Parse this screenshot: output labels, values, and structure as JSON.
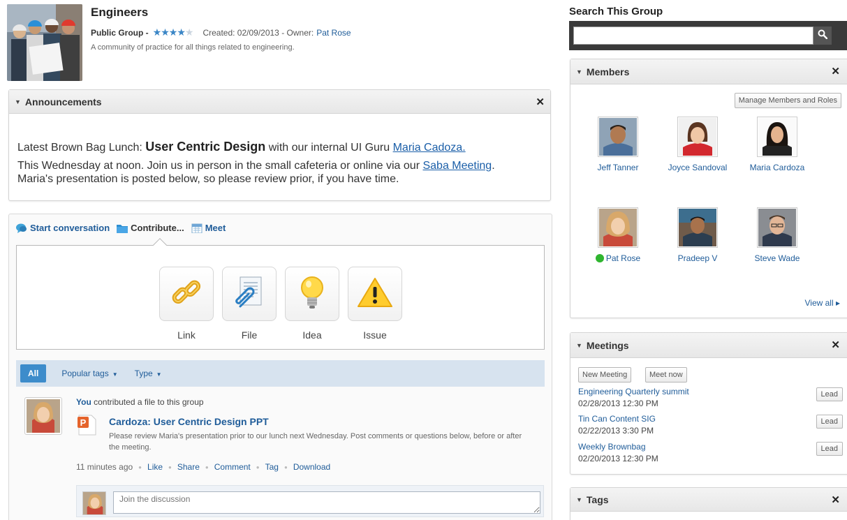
{
  "group": {
    "title": "Engineers",
    "type_label": "Public Group -",
    "rating": 4,
    "rating_max": 5,
    "created": "Created: 02/09/2013 - Owner:",
    "owner": "Pat Rose",
    "description": "A community of practice for all things related to engineering."
  },
  "announcements": {
    "title": "Announcements",
    "line1_prefix": "Latest Brown Bag Lunch: ",
    "line1_bold": "User Centric Design",
    "line1_mid": " with our internal UI Guru ",
    "line1_link": "Maria Cadoza.",
    "line2_prefix": "This Wednesday at noon. Join us in person in the small cafeteria or online via our ",
    "line2_link": "Saba Meeting",
    "line2_suffix": ".",
    "line3": "Maria's presentation is posted below, so please review prior, if you have time."
  },
  "activity": {
    "tabs": [
      {
        "label": "Start conversation",
        "icon": "conversation-icon"
      },
      {
        "label": "Contribute...",
        "icon": "folder-icon"
      },
      {
        "label": "Meet",
        "icon": "calendar-icon"
      }
    ],
    "contribute_options": [
      {
        "label": "Link",
        "icon": "link-chain-icon"
      },
      {
        "label": "File",
        "icon": "file-paperclip-icon"
      },
      {
        "label": "Idea",
        "icon": "lightbulb-icon"
      },
      {
        "label": "Issue",
        "icon": "warning-icon"
      }
    ],
    "filters": {
      "all": "All",
      "popular_tags": "Popular tags",
      "type": "Type"
    },
    "post": {
      "actor": "You",
      "action": " contributed a file to this group",
      "title": "Cardoza: User Centric Design PPT",
      "description": "Please review Maria's presentation prior to our lunch next Wednesday. Post comments or questions below, before or after the meeting.",
      "time": "11 minutes ago",
      "actions": [
        "Like",
        "Share",
        "Comment",
        "Tag",
        "Download"
      ]
    },
    "discussion_placeholder": "Join the discussion"
  },
  "search": {
    "label": "Search This Group",
    "value": ""
  },
  "members": {
    "title": "Members",
    "manage_label": "Manage Members and Roles",
    "people": [
      {
        "name": "Jeff Tanner",
        "online": false
      },
      {
        "name": "Joyce Sandoval",
        "online": false
      },
      {
        "name": "Maria Cardoza",
        "online": false
      },
      {
        "name": "Pat Rose",
        "online": true
      },
      {
        "name": "Pradeep V",
        "online": false
      },
      {
        "name": "Steve Wade",
        "online": false
      }
    ],
    "view_all": "View all ▸"
  },
  "meetings": {
    "title": "Meetings",
    "new_label": "New Meeting",
    "now_label": "Meet now",
    "lead_label": "Lead",
    "items": [
      {
        "title": "Engineering Quarterly summit",
        "date": "02/28/2013 12:30 PM"
      },
      {
        "title": "Tin Can Content SIG",
        "date": "02/22/2013 3:30 PM"
      },
      {
        "title": "Weekly Brownbag",
        "date": "02/20/2013 12:30 PM"
      }
    ]
  },
  "tags": {
    "title": "Tags"
  },
  "colors": {
    "accent": "#3d8ccb",
    "link": "#1f5c99",
    "online": "#2fb52f"
  }
}
